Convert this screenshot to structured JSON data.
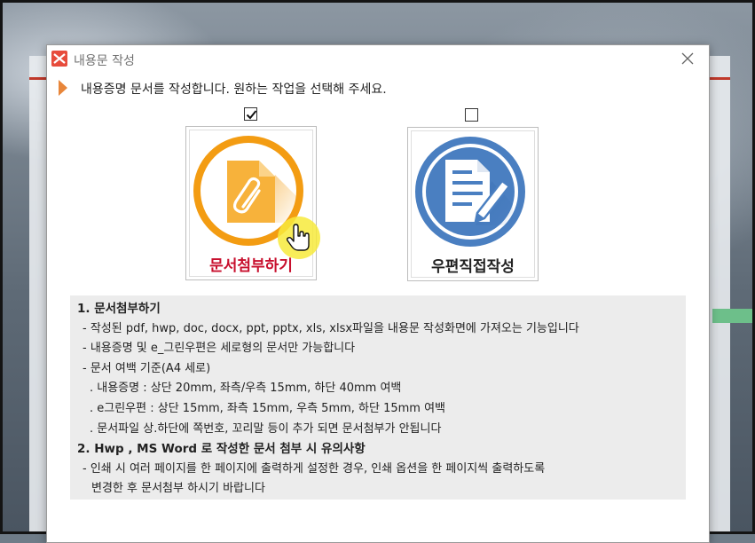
{
  "dialog": {
    "title": "내용문 작성",
    "instruction": "내용증명 문서를 작성합니다. 원하는 작업을 선택해 주세요."
  },
  "options": [
    {
      "label": "문서첨부하기",
      "checked": true,
      "label_color": "#c8102e",
      "icon": "paperclip-document-icon",
      "ring_color": "#f39c12"
    },
    {
      "label": "우편직접작성",
      "checked": false,
      "label_color": "#222222",
      "icon": "document-pencil-icon",
      "ring_color": "#4a7fc1"
    }
  ],
  "info": {
    "section1_title": "1. 문서첨부하기",
    "section1_lines": [
      "- 작성된 pdf, hwp, doc, docx, ppt, pptx, xls, xlsx파일을 내용문 작성화면에 가져오는 기능입니다",
      "- 내용증명 및 e_그린우편은 세로형의 문서만 가능합니다",
      "- 문서 여백 기준(A4 세로)"
    ],
    "section1_sublines": [
      ". 내용증명  : 상단 20mm, 좌측/우측 15mm, 하단 40mm 여백",
      ". e그린우편 : 상단 15mm, 좌측 15mm, 우측 5mm, 하단 15mm 여백",
      ". 문서파일 상.하단에 쪽번호, 꼬리말 등이 추가 되면 문서첨부가 안됩니다"
    ],
    "section2_title": "2. Hwp , MS Word 로 작성한 문서 첨부 시  유의사항",
    "section2_lines": [
      "- 인쇄 시 여러 페이지를 한 페이지에  출력하게 설정한 경우, 인쇄 옵션을 한 페이지씩 출력하도록",
      "변경한 후 문서첨부 하시기 바랍니다"
    ]
  },
  "icons": {
    "app": "app-logo-icon",
    "close": "close-icon",
    "instruction": "arrow-right-icon",
    "cursor": "hand-pointer-icon"
  },
  "colors": {
    "app_icon": "#e74c3c",
    "instruction_arrow": "#e8863a",
    "cursor_highlight": "#f7ea3c"
  }
}
